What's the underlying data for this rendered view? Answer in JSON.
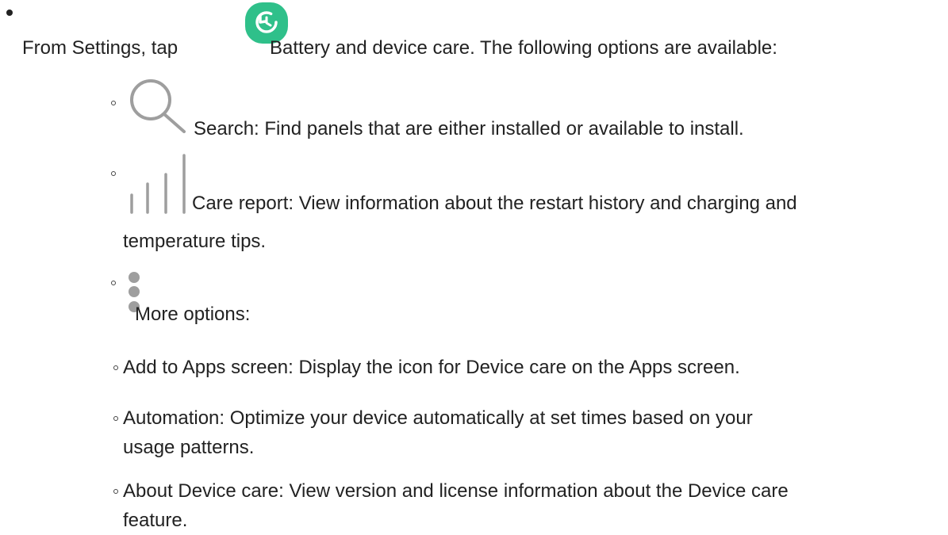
{
  "intro": {
    "lead": "From Settings, tap",
    "icon": "device-care-icon",
    "rest": "Battery and device care. The following options are available:"
  },
  "options": [
    {
      "icon": "search-icon",
      "text": "Search: Find panels that are either installed or available to install."
    },
    {
      "icon": "care-report-icon",
      "line1": "Care report: View information about the restart history and charging and",
      "line2": "temperature tips."
    },
    {
      "icon": "more-options-icon",
      "text": "More options:"
    }
  ],
  "more_options": [
    {
      "text": "Add to Apps screen: Display the icon for Device care on the Apps screen."
    },
    {
      "line1": "Automation: Optimize your device automatically at set times based on your",
      "line2": "usage patterns."
    },
    {
      "line1": "About Device care: View version and license information about the Device care",
      "line2": "feature."
    }
  ],
  "colors": {
    "text": "#222222",
    "icon_green": "#2FC08A",
    "icon_gray": "#9E9E9E"
  }
}
